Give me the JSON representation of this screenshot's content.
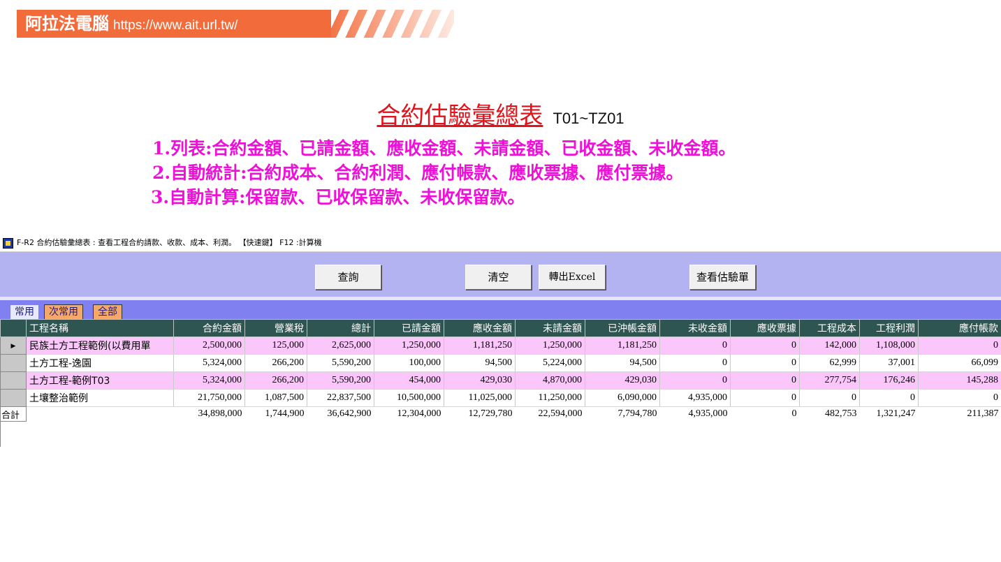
{
  "banner": {
    "brand": "阿拉法電腦",
    "url": "https://www.ait.url.tw/"
  },
  "heading": {
    "title": "合約估驗彙總表",
    "code": "T01~TZ01",
    "features": [
      "1.列表:合約金額、已請金額、應收金額、未請金額、已收金額、未收金額。",
      "2.自動統計:合約成本、合約利潤、應付帳款、應收票據、應付票據。",
      "3.自動計算:保留款、已收保留款、未收保留款。"
    ]
  },
  "window": {
    "title": "F-R2 合約估驗彙總表 : 查看工程合約請款、收款、成本、利潤。 【快速鍵】 F12 :計算機"
  },
  "toolbar": {
    "query_label": "查詢",
    "clear_label": "清空",
    "export_label": "轉出Excel",
    "view_label": "查看估驗單"
  },
  "tabs": {
    "common": "常用",
    "secondary": "次常用",
    "all": "全部"
  },
  "grid": {
    "columns": [
      "工程名稱",
      "合約金額",
      "營業稅",
      "總計",
      "已請金額",
      "應收金額",
      "未請金額",
      "已沖帳金額",
      "未收金額",
      "應收票據",
      "工程成本",
      "工程利潤",
      "應付帳款"
    ],
    "rows": [
      [
        "民族土方工程範例(以費用單",
        "2,500,000",
        "125,000",
        "2,625,000",
        "1,250,000",
        "1,181,250",
        "1,250,000",
        "1,181,250",
        "0",
        "0",
        "142,000",
        "1,108,000",
        "0"
      ],
      [
        "土方工程-逸園",
        "5,324,000",
        "266,200",
        "5,590,200",
        "100,000",
        "94,500",
        "5,224,000",
        "94,500",
        "0",
        "0",
        "62,999",
        "37,001",
        "66,099"
      ],
      [
        "土方工程-範例T03",
        "5,324,000",
        "266,200",
        "5,590,200",
        "454,000",
        "429,030",
        "4,870,000",
        "429,030",
        "0",
        "0",
        "277,754",
        "176,246",
        "145,288"
      ],
      [
        "土壤整治範例",
        "21,750,000",
        "1,087,500",
        "22,837,500",
        "10,500,000",
        "11,025,000",
        "11,250,000",
        "6,090,000",
        "4,935,000",
        "0",
        "0",
        "0",
        "0"
      ]
    ],
    "total_label": "合計",
    "totals": [
      "34,898,000",
      "1,744,900",
      "36,642,900",
      "12,304,000",
      "12,729,780",
      "22,594,000",
      "7,794,780",
      "4,935,000",
      "0",
      "482,753",
      "1,321,247",
      "211,387"
    ]
  },
  "colors": {
    "banner": "#f26b3a",
    "title_red": "#e0141c",
    "feature_magenta": "#ee10d8",
    "toolbar": "#b3b3f2",
    "tabbar": "#8080f0",
    "header": "#2f5553",
    "row_pink": "#fbc7fb"
  }
}
